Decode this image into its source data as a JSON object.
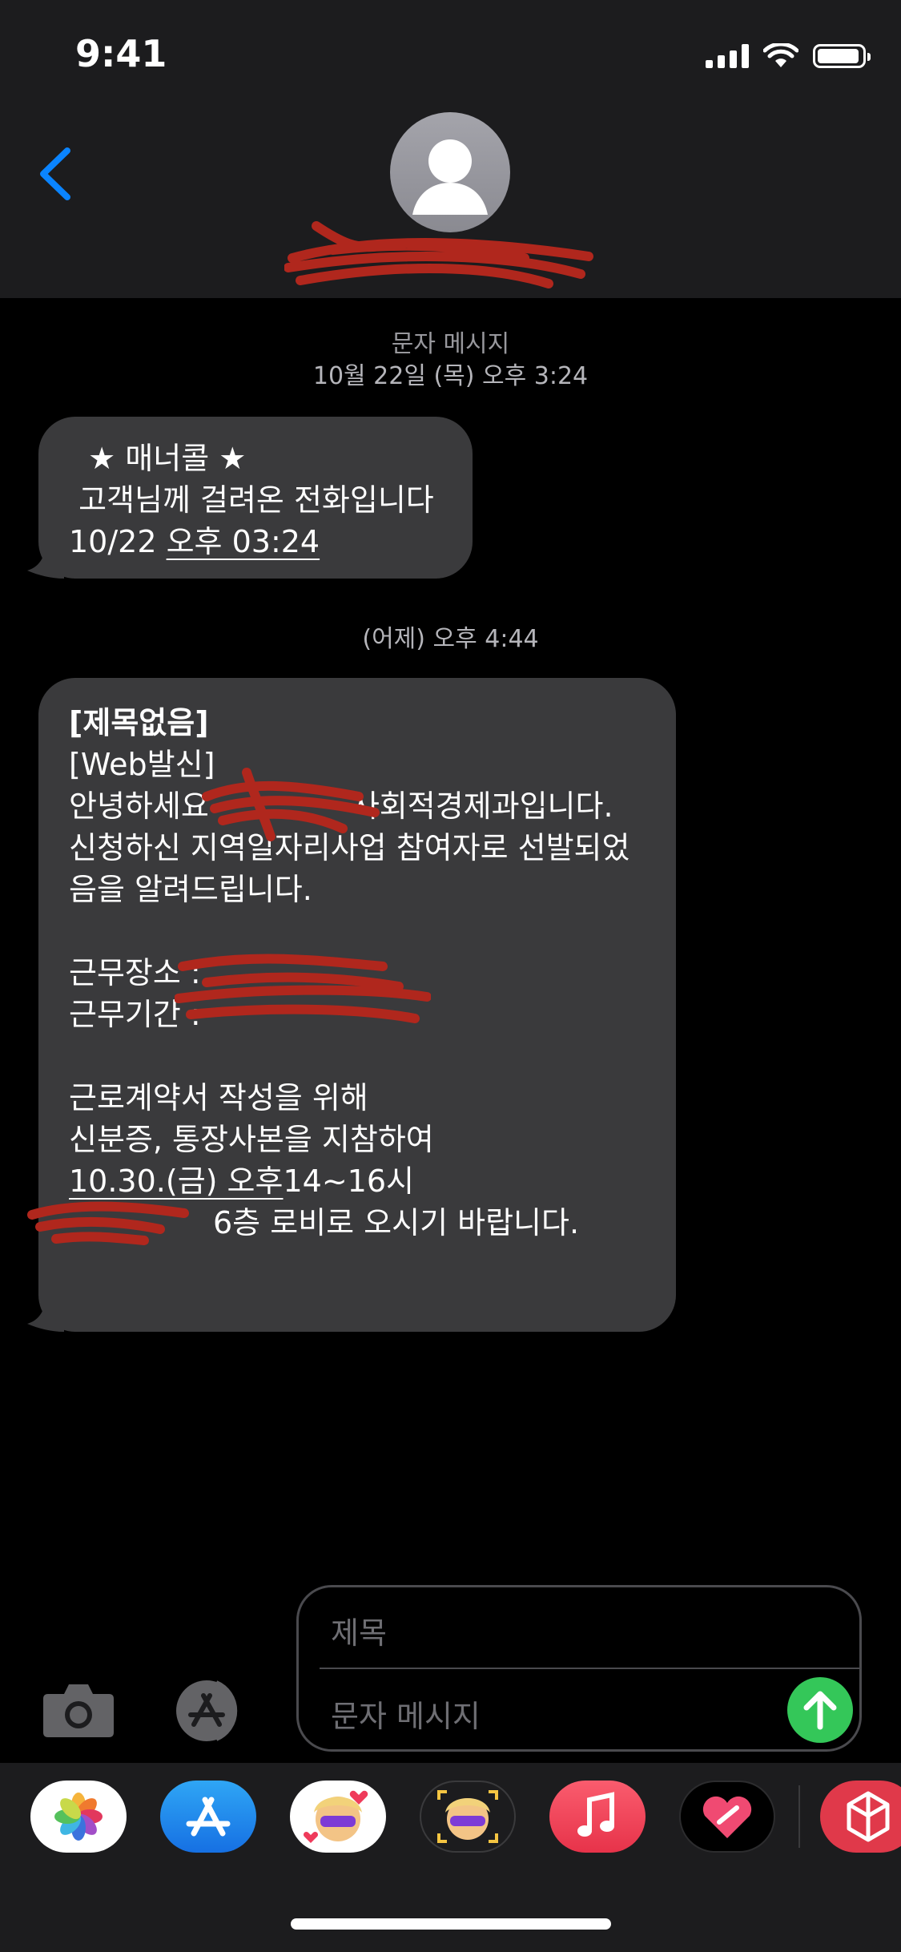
{
  "status_bar": {
    "time": "9:41"
  },
  "header": {
    "contact_name": ""
  },
  "thread": [
    {
      "timestamp_label": "문자 메시지",
      "timestamp_date": "10월 22일 (목) 오후 3:24",
      "message_lines": [
        "  ★ 매너콜 ★",
        " 고객님께 걸려온 전화입니다",
        "10/22 ",
        "오후 03:24"
      ]
    },
    {
      "timestamp_date": "(어제) 오후 4:44",
      "message_lines": [
        "[제목없음]",
        "[Web발신]",
        "안녕하세요",
        "사회적경제과입니다.",
        "신청하신 지역일자리사업 참여자로 선발되었",
        "음을 알려드립니다.",
        "근무장소 : ",
        "근무기간 : ",
        "근로계약서 작성을 위해",
        "신분증, 통장사본을 지참하여",
        "10.30.(금) 오후",
        "14~16시",
        "6층 로비로 오시기 바랍니다."
      ]
    }
  ],
  "composer": {
    "subject_placeholder": "제목",
    "message_placeholder": "문자 메시지"
  },
  "app_drawer": {
    "apps": [
      "photos-app",
      "app-store-app",
      "memoji-stickers-app",
      "animoji-app",
      "music-app",
      "digital-touch-app",
      "extra-app"
    ]
  },
  "colors": {
    "bubble": "#3a3a3c",
    "send": "#34c759",
    "back_accent": "#0a84ff",
    "redaction": "#b0271d"
  }
}
